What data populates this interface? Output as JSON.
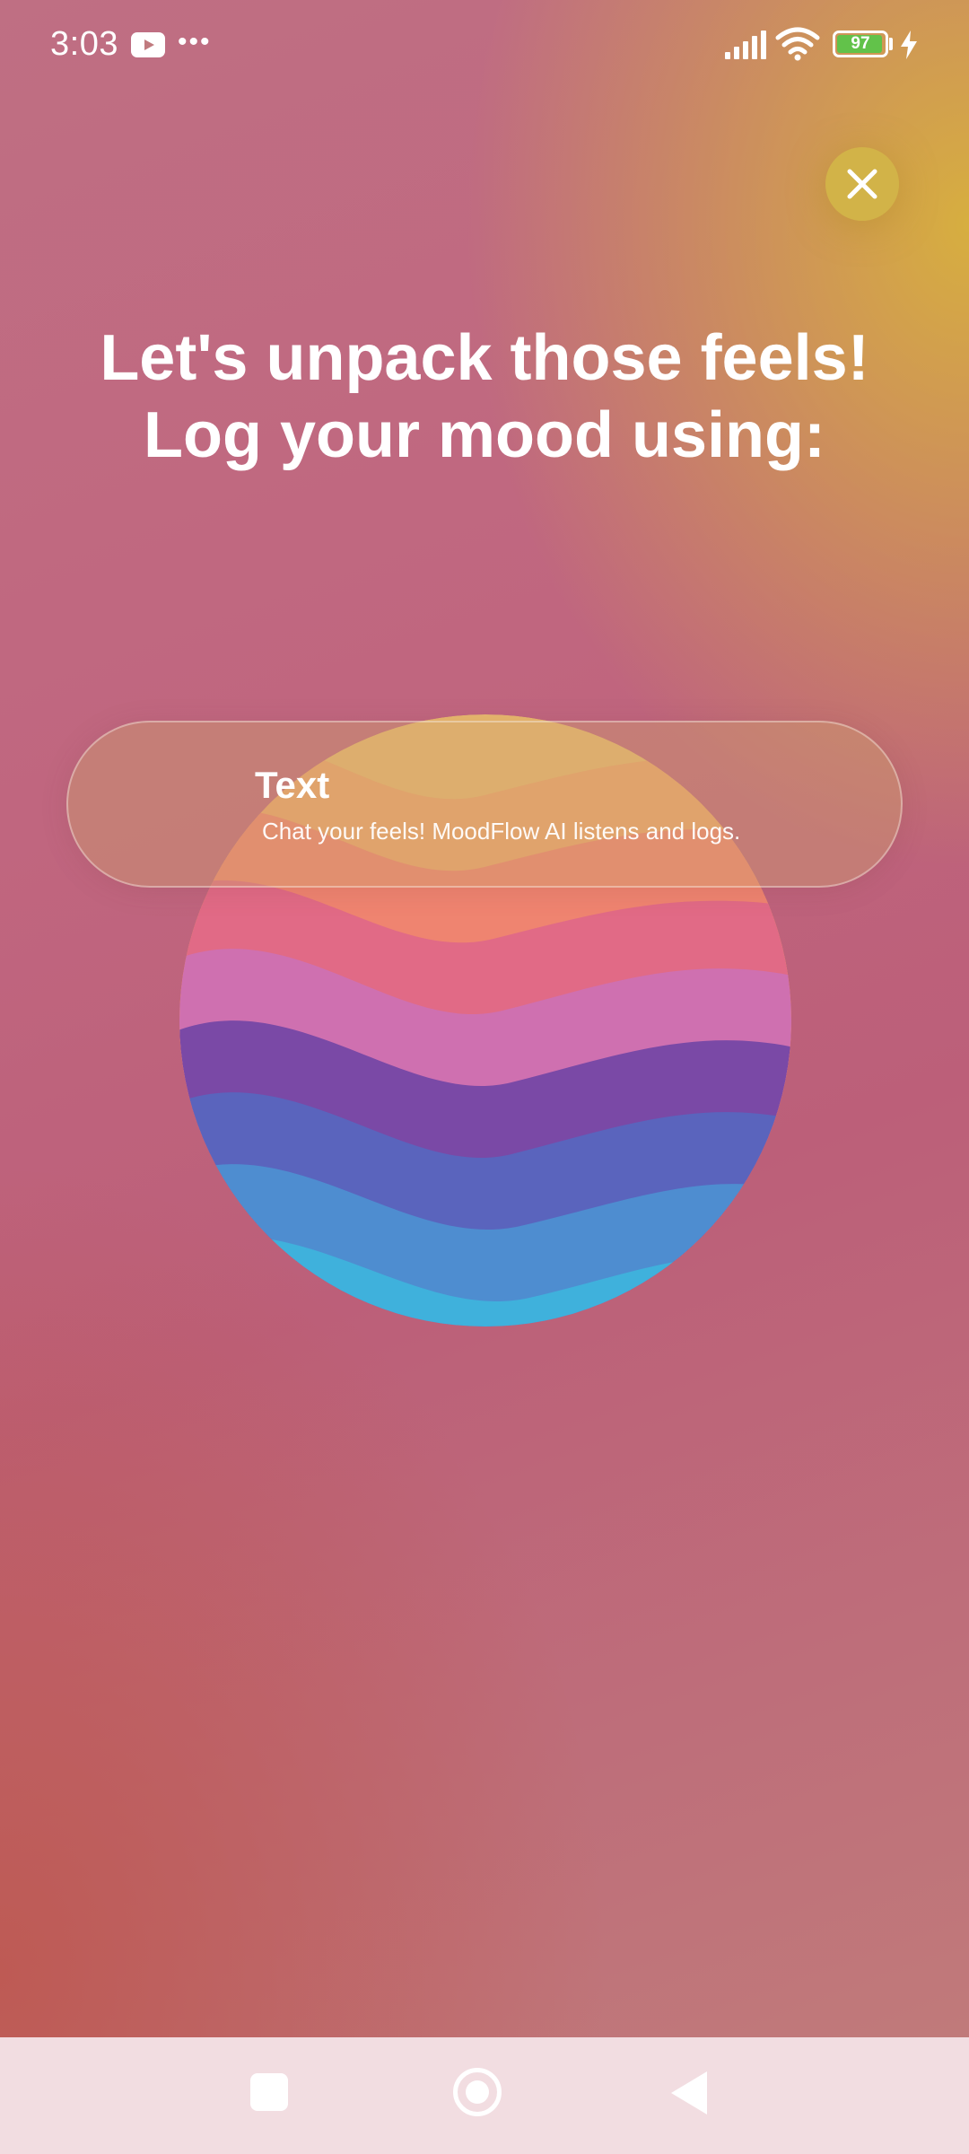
{
  "status_bar": {
    "time": "3:03",
    "notification_icons": [
      "youtube-icon",
      "more-dots-icon"
    ],
    "battery_level": "97",
    "system_icons": [
      "signal-icon",
      "wifi-icon",
      "battery-icon",
      "charging-bolt-icon"
    ]
  },
  "header": {
    "close_icon": "close-icon",
    "title_line1": "Let's unpack those feels!",
    "title_line2": "Log your mood using:"
  },
  "options": [
    {
      "title": "Text",
      "description": "Chat your feels! MoodFlow AI listens and logs."
    }
  ],
  "nav_bar": {
    "buttons": [
      "recents-button",
      "home-button",
      "back-button"
    ]
  },
  "colors": {
    "accent_gold": "#d8b23c",
    "background_rose": "#bf6f83",
    "nav_bar_bg": "#f2dde1",
    "battery_green": "#62c24a"
  }
}
